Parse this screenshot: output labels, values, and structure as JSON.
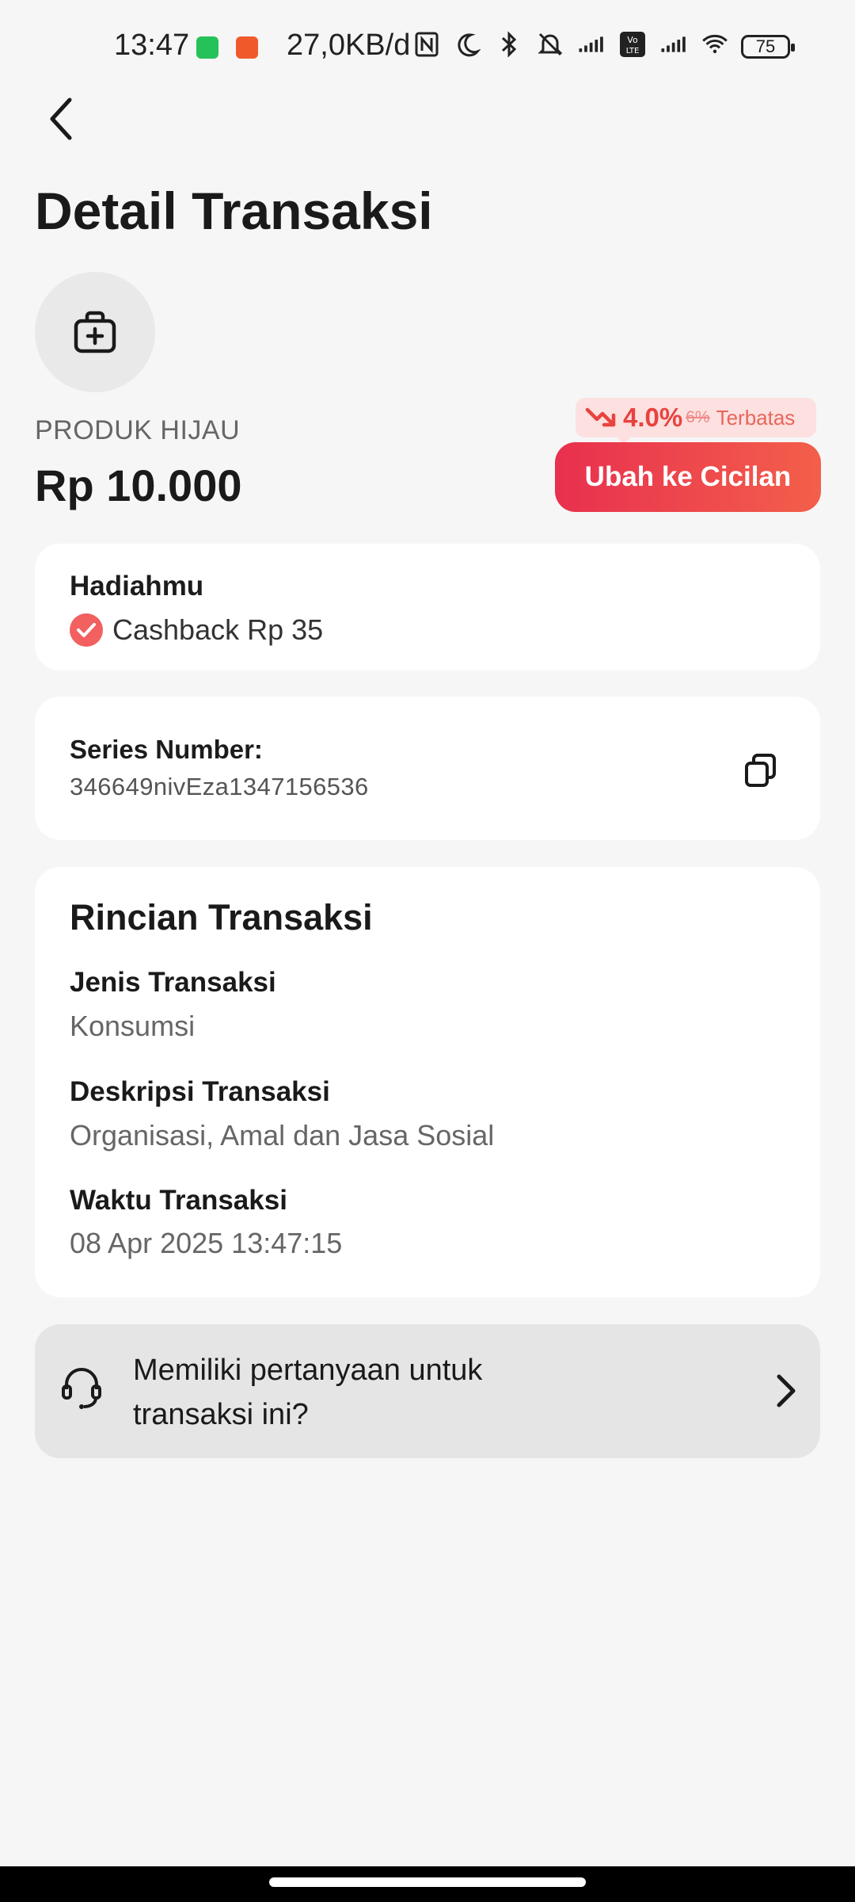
{
  "status_bar": {
    "time": "13:47",
    "network_speed": "27,0KB/d",
    "battery": "75",
    "icons": [
      "whatsapp-icon",
      "shop-icon",
      "nfc-icon",
      "moon-icon",
      "bluetooth-icon",
      "bell-off-icon",
      "signal-icon",
      "volte-icon",
      "signal-icon",
      "wifi-icon"
    ]
  },
  "header": {
    "title": "Detail Transaksi"
  },
  "product": {
    "icon": "medical-bag-icon",
    "name": "PRODUK HIJAU",
    "amount": "Rp 10.000"
  },
  "promo": {
    "rate": "4.0%",
    "old_rate": "6%",
    "label": "Terbatas",
    "button_label": "Ubah ke Cicilan",
    "colors": {
      "accent": "#e8304f",
      "badge_bg": "#fde0e0"
    }
  },
  "reward": {
    "title": "Hadiahmu",
    "text": "Cashback Rp 35"
  },
  "serial": {
    "label": "Series Number:",
    "value": "346649nivEza1347156536"
  },
  "details": {
    "heading": "Rincian Transaksi",
    "fields": [
      {
        "label": "Jenis Transaksi",
        "value": "Konsumsi"
      },
      {
        "label": "Deskripsi Transaksi",
        "value": "Organisasi, Amal dan Jasa Sosial"
      },
      {
        "label": "Waktu Transaksi",
        "value": "08 Apr 2025 13:47:15"
      }
    ]
  },
  "support": {
    "text": "Memiliki pertanyaan untuk transaksi ini?"
  }
}
